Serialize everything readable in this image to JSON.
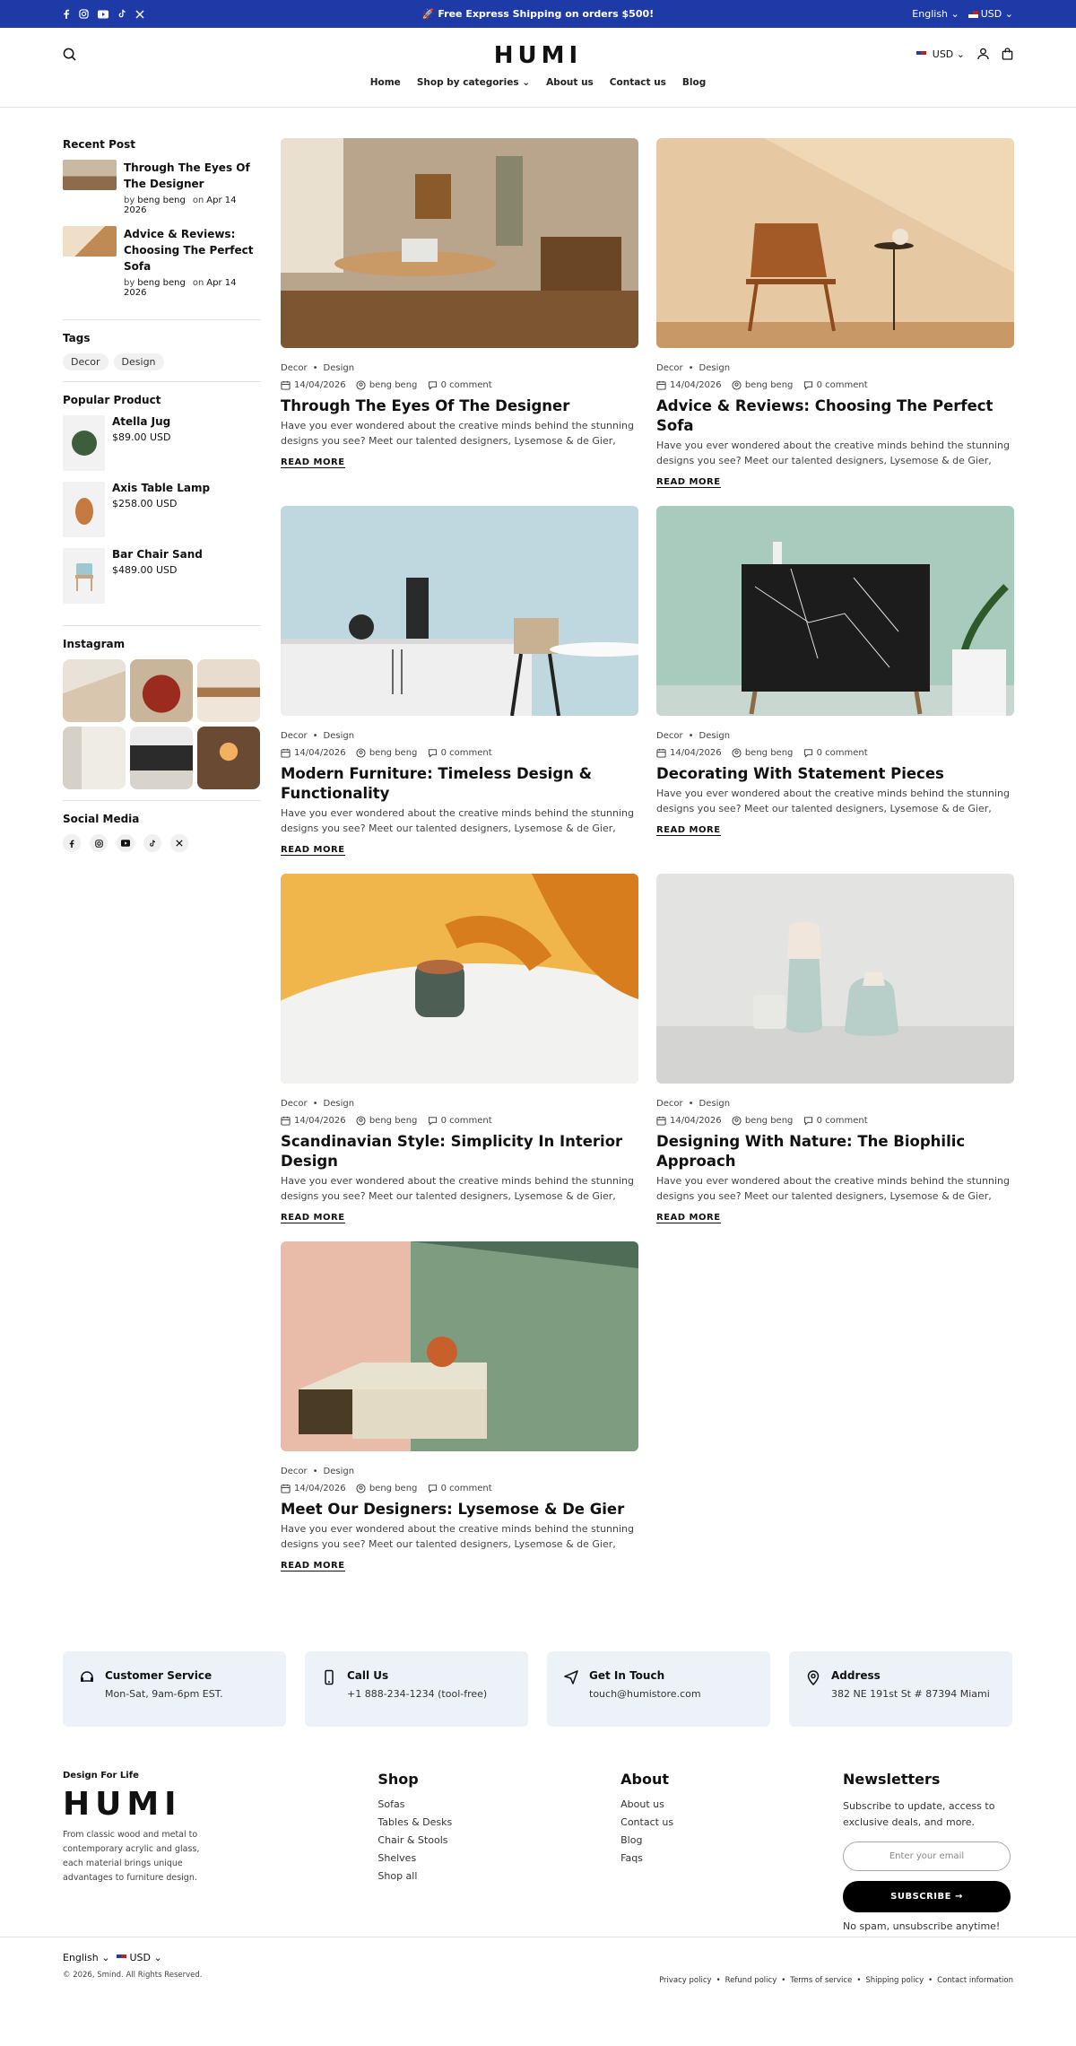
{
  "topbar": {
    "promo": "🚀 Free Express Shipping on orders $500!",
    "language": "English",
    "currency": "USD",
    "socials": [
      "facebook",
      "instagram",
      "youtube",
      "tiktok",
      "x"
    ]
  },
  "header": {
    "logo": "HUMI",
    "currency": "USD",
    "nav": [
      "Home",
      "Shop by categories",
      "About us",
      "Contact us",
      "Blog"
    ]
  },
  "sidebar": {
    "recent_title": "Recent Post",
    "recent": [
      {
        "title": "Through The Eyes Of The Designer",
        "by": "by",
        "author": "beng beng",
        "on": "on",
        "date": "Apr 14 2026"
      },
      {
        "title": "Advice & Reviews: Choosing The Perfect Sofa",
        "by": "by",
        "author": "beng beng",
        "on": "on",
        "date": "Apr 14 2026"
      }
    ],
    "tags_title": "Tags",
    "tags": [
      "Decor",
      "Design"
    ],
    "popular_title": "Popular Product",
    "products": [
      {
        "name": "Atella Jug",
        "price": "$89.00 USD"
      },
      {
        "name": "Axis Table Lamp",
        "price": "$258.00 USD"
      },
      {
        "name": "Bar Chair Sand",
        "price": "$489.00 USD"
      }
    ],
    "instagram_title": "Instagram",
    "social_title": "Social Media"
  },
  "posts": [
    {
      "cat1": "Decor",
      "cat2": "Design",
      "date": "14/04/2026",
      "author": "beng beng",
      "comments": "0 comment",
      "title": "Through The Eyes Of The Designer",
      "excerpt": "Have you ever wondered about the creative minds behind the stunning designs you see? Meet our talented designers, Lysemose & de Gier, who...",
      "more": "READ MORE"
    },
    {
      "cat1": "Decor",
      "cat2": "Design",
      "date": "14/04/2026",
      "author": "beng beng",
      "comments": "0 comment",
      "title": "Advice & Reviews: Choosing The Perfect Sofa",
      "excerpt": "Have you ever wondered about the creative minds behind the stunning designs you see? Meet our talented designers, Lysemose & de Gier, who...",
      "more": "READ MORE"
    },
    {
      "cat1": "Decor",
      "cat2": "Design",
      "date": "14/04/2026",
      "author": "beng beng",
      "comments": "0 comment",
      "title": "Modern Furniture: Timeless Design & Functionality",
      "excerpt": "Have you ever wondered about the creative minds behind the stunning designs you see? Meet our talented designers, Lysemose & de Gier, who...",
      "more": "READ MORE"
    },
    {
      "cat1": "Decor",
      "cat2": "Design",
      "date": "14/04/2026",
      "author": "beng beng",
      "comments": "0 comment",
      "title": "Decorating With Statement Pieces",
      "excerpt": "Have you ever wondered about the creative minds behind the stunning designs you see? Meet our talented designers, Lysemose & de Gier, who...",
      "more": "READ MORE"
    },
    {
      "cat1": "Decor",
      "cat2": "Design",
      "date": "14/04/2026",
      "author": "beng beng",
      "comments": "0 comment",
      "title": "Scandinavian Style: Simplicity In Interior Design",
      "excerpt": "Have you ever wondered about the creative minds behind the stunning designs you see? Meet our talented designers, Lysemose & de Gier, who...",
      "more": "READ MORE"
    },
    {
      "cat1": "Decor",
      "cat2": "Design",
      "date": "14/04/2026",
      "author": "beng beng",
      "comments": "0 comment",
      "title": "Designing With Nature: The Biophilic Approach",
      "excerpt": "Have you ever wondered about the creative minds behind the stunning designs you see? Meet our talented designers, Lysemose & de Gier, who...",
      "more": "READ MORE"
    },
    {
      "cat1": "Decor",
      "cat2": "Design",
      "date": "14/04/2026",
      "author": "beng beng",
      "comments": "0 comment",
      "title": "Meet Our Designers: Lysemose & De Gier",
      "excerpt": "Have you ever wondered about the creative minds behind the stunning designs you see? Meet our talented designers, Lysemose & de Gier, who...",
      "more": "READ MORE"
    }
  ],
  "contacts": [
    {
      "title": "Customer Service",
      "value": "Mon-Sat, 9am-6pm EST."
    },
    {
      "title": "Call Us",
      "value": "+1 888-234-1234 (tool-free)"
    },
    {
      "title": "Get In Touch",
      "value": "touch@humistore.com"
    },
    {
      "title": "Address",
      "value": "382 NE 191st St # 87394 Miami"
    }
  ],
  "footer": {
    "tagline": "Design For Life",
    "logo": "HUMI",
    "desc": "From classic wood and metal to contemporary acrylic and glass, each material brings unique advantages to furniture design.",
    "shop_title": "Shop",
    "shop_links": [
      "Sofas",
      "Tables & Desks",
      "Chair & Stools",
      "Shelves",
      "Shop all"
    ],
    "about_title": "About",
    "about_links": [
      "About us",
      "Contact us",
      "Blog",
      "Faqs"
    ],
    "news_title": "Newsletters",
    "news_desc": "Subscribe to update, access to exclusive deals, and more.",
    "email_placeholder": "Enter your email",
    "subscribe": "SUBSCRIBE →",
    "note": "No spam, unsubscribe anytime!"
  },
  "bottom": {
    "language": "English",
    "currency": "USD",
    "copyright": "© 2026, Smind. All Rights Reserved.",
    "links": [
      "Privacy policy",
      "Refund policy",
      "Terms of service",
      "Shipping policy",
      "Contact information"
    ]
  }
}
